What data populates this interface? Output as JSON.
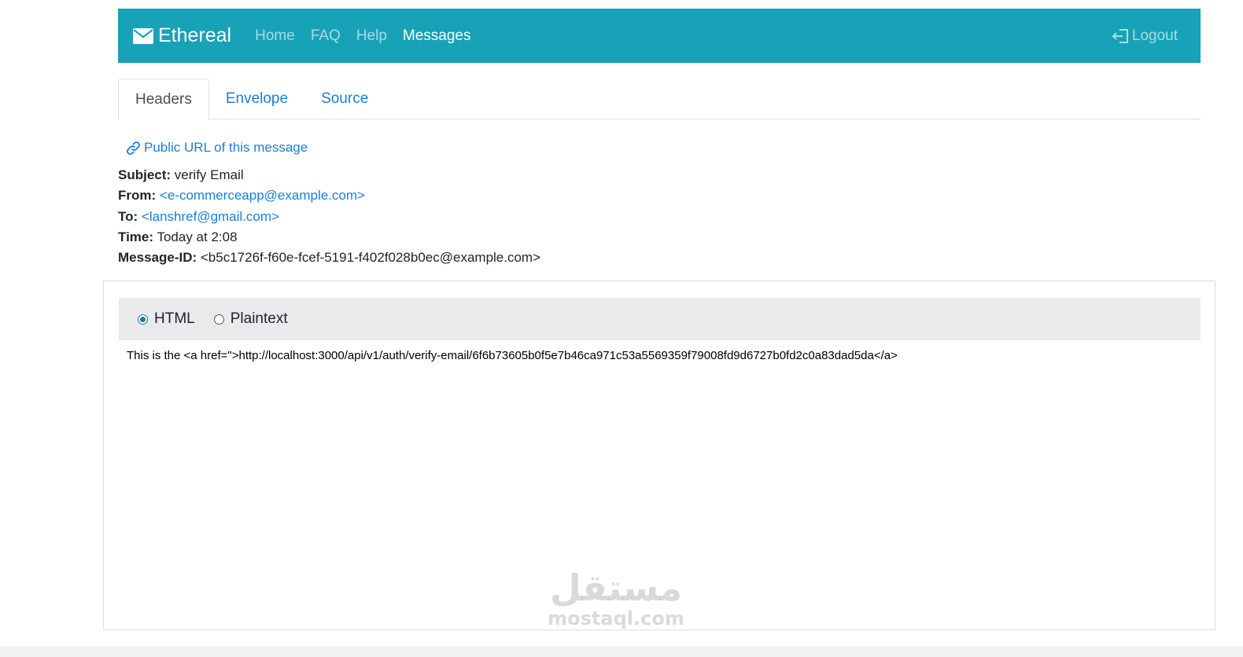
{
  "navbar": {
    "brand": "Ethereal",
    "links": [
      {
        "label": "Home"
      },
      {
        "label": "FAQ"
      },
      {
        "label": "Help"
      },
      {
        "label": "Messages",
        "active": true
      }
    ],
    "logout": "Logout",
    "bg_color": "#17a2b8"
  },
  "tabs": [
    {
      "label": "Headers",
      "active": true
    },
    {
      "label": "Envelope"
    },
    {
      "label": "Source"
    }
  ],
  "public_url_label": "Public URL of this message",
  "headers": {
    "subject": {
      "label": "Subject:",
      "value": "verify Email"
    },
    "from": {
      "label": "From:",
      "value": "<e-commerceapp@example.com>"
    },
    "to": {
      "label": "To:",
      "value": "<lanshref@gmail.com>"
    },
    "time": {
      "label": "Time:",
      "value": "Today at 2:08"
    },
    "message_id": {
      "label": "Message-ID:",
      "value": "<b5c1726f-f60e-fcef-5191-f402f028b0ec@example.com>"
    }
  },
  "view_toggle": {
    "options": [
      {
        "label": "HTML",
        "selected": true
      },
      {
        "label": "Plaintext",
        "selected": false
      }
    ]
  },
  "email_body": "This is the <a href=\">http://localhost:3000/api/v1/auth/verify-email/6f6b73605b0f5e7b46ca971c53a5569359f79008fd9d6727b0fd2c0a83dad5da</a>",
  "watermark": {
    "arabic": "مستقل",
    "latin": "mostaql.com"
  }
}
